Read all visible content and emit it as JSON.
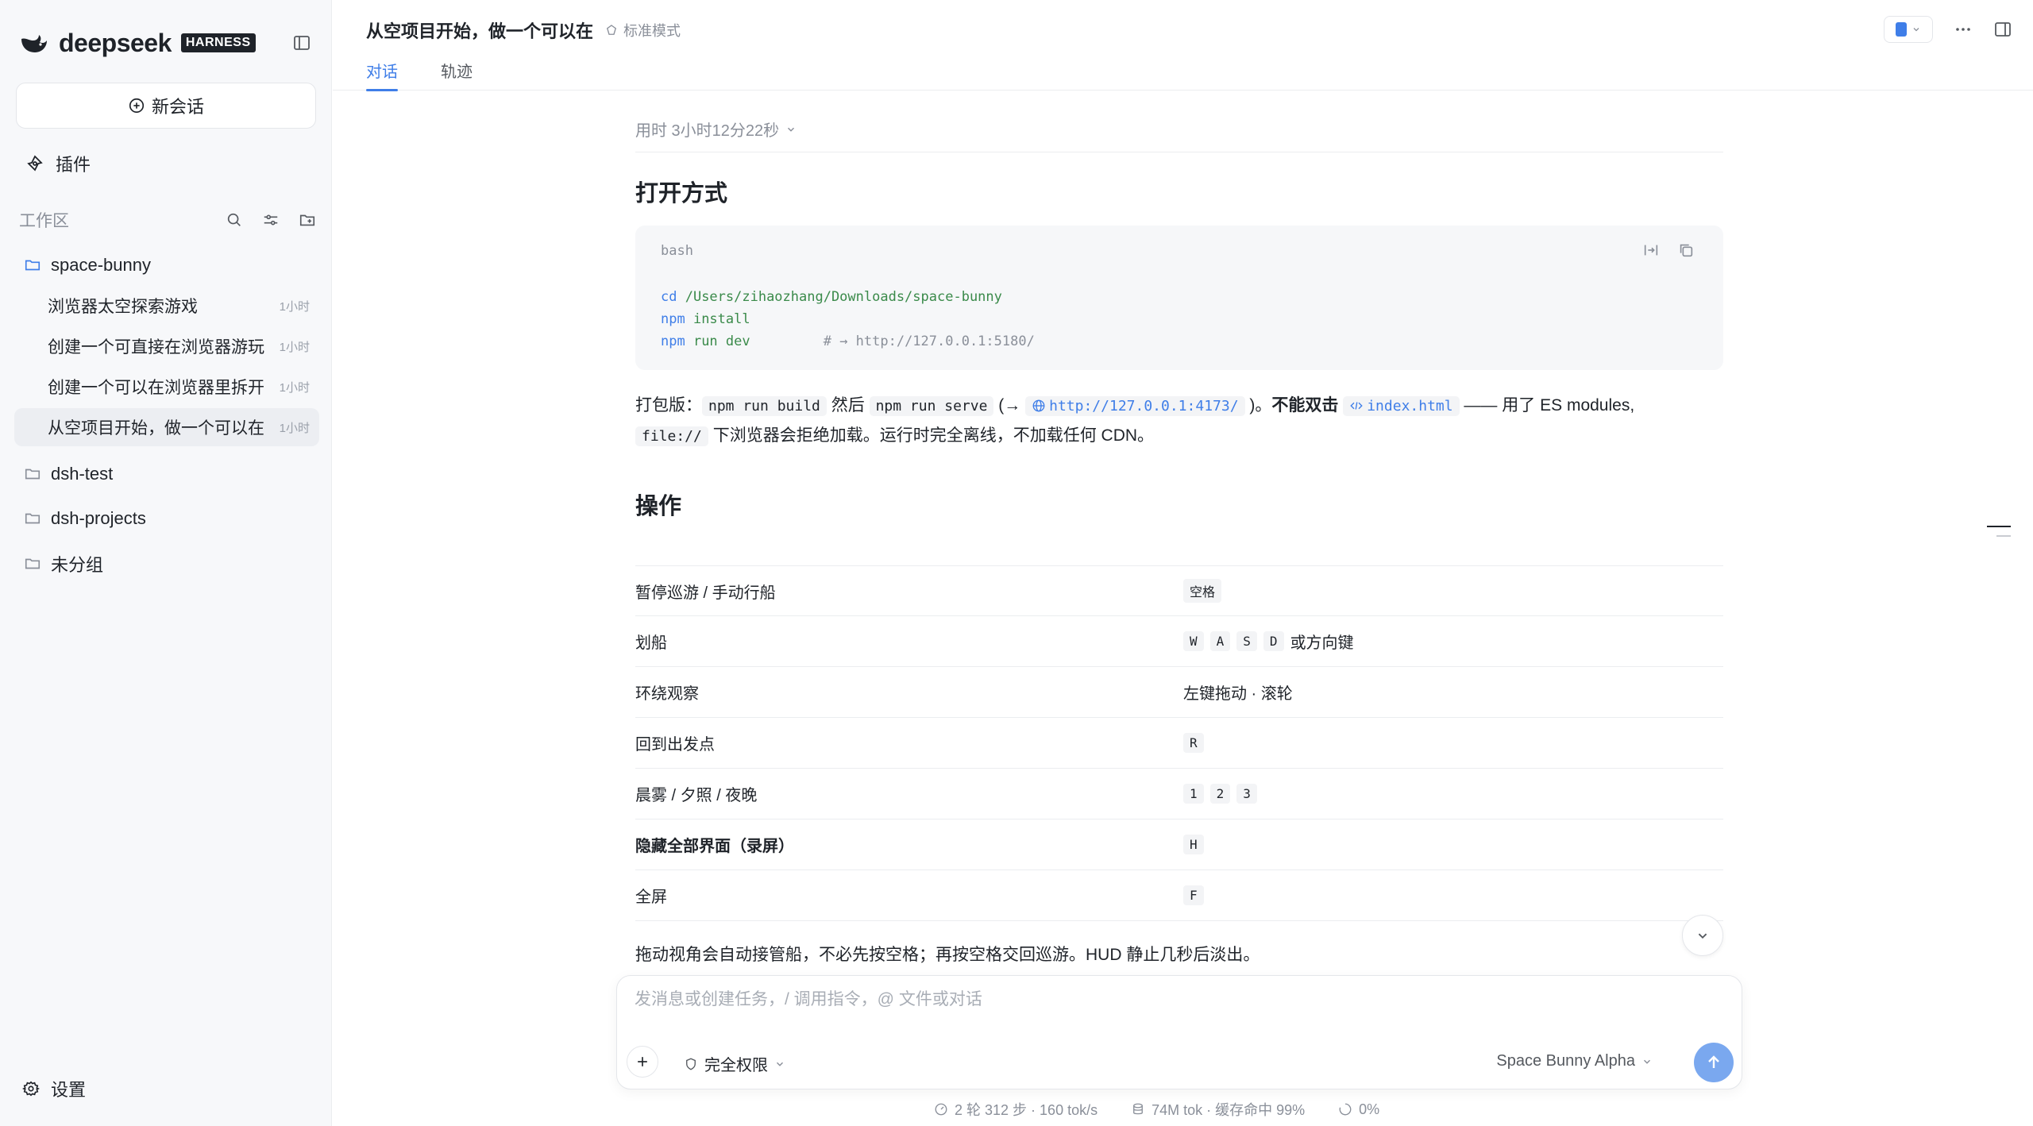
{
  "sidebar": {
    "brand_name": "deepseek",
    "brand_badge": "HARNESS",
    "new_chat_label": "新会话",
    "plugins_label": "插件",
    "workspace_title": "工作区",
    "folders": [
      {
        "name": "space-bunny",
        "sessions": [
          {
            "label": "浏览器太空探索游戏",
            "time": "1小时"
          },
          {
            "label": "创建一个可直接在浏览器游玩",
            "time": "1小时"
          },
          {
            "label": "创建一个可以在浏览器里拆开",
            "time": "1小时"
          },
          {
            "label": "从空项目开始，做一个可以在",
            "time": "1小时"
          }
        ]
      },
      {
        "name": "dsh-test"
      },
      {
        "name": "dsh-projects"
      },
      {
        "name": "未分组"
      }
    ],
    "settings_label": "设置"
  },
  "header": {
    "conversation_title": "从空项目开始，做一个可以在",
    "mode_label": "标准模式",
    "tabs": [
      "对话",
      "轨迹"
    ]
  },
  "content": {
    "elapsed": "用时 3小时12分22秒",
    "section_open": "打开方式",
    "code": {
      "lang": "bash",
      "line1_cmd": "cd",
      "line1_arg": " /Users/zihaozhang/Downloads/space-bunny",
      "line2_cmd": "npm",
      "line2_arg": " install",
      "line3_cmd": "npm",
      "line3_arg": " run dev",
      "line3_comment": "         # → http://127.0.0.1:5180/"
    },
    "para1": {
      "prefix": "打包版：",
      "code_build": "npm run build",
      "then": " 然后 ",
      "code_serve": "npm run serve",
      "arrow": " (→ ",
      "url": "http://127.0.0.1:4173/",
      "close": " )。",
      "no_dbl": "不能双击",
      "file": "index.html",
      "rest": " —— 用了 ES modules,"
    },
    "para2": {
      "code_file": "file://",
      "rest": " 下浏览器会拒绝加载。运行时完全离线，不加载任何 CDN。"
    },
    "section_ops": "操作",
    "ops": [
      {
        "action": "暂停巡游 / 手动行船",
        "keys": [
          "空格"
        ],
        "suffix": ""
      },
      {
        "action": "划船",
        "keys": [
          "W",
          "A",
          "S",
          "D"
        ],
        "suffix": "或方向键"
      },
      {
        "action": "环绕观察",
        "keys": [],
        "suffix": "左键拖动 · 滚轮"
      },
      {
        "action": "回到出发点",
        "keys": [
          "R"
        ],
        "suffix": ""
      },
      {
        "action": "晨雾 / 夕照 / 夜晚",
        "keys": [
          "1",
          "2",
          "3"
        ],
        "suffix": ""
      },
      {
        "action": "隐藏全部界面（录屏）",
        "keys": [
          "H"
        ],
        "suffix": "",
        "bold": true
      },
      {
        "action": "全屏",
        "keys": [
          "F"
        ],
        "suffix": ""
      }
    ],
    "tip": "拖动视角会自动接管船，不必先按空格；再按空格交回巡游。HUD 静止几秒后淡出。"
  },
  "composer": {
    "placeholder": "发消息或创建任务，/ 调用指令，@ 文件或对话",
    "permission_label": "完全权限",
    "model_label": "Space Bunny Alpha"
  },
  "status": {
    "steps": "2 轮 312 步 · 160 tok/s",
    "tokens": "74M tok · 缓存命中 99%",
    "progress": "0%"
  },
  "colors": {
    "accent": "#3f7ee8",
    "send_button": "#7aa8ef",
    "sidebar_bg": "#f7f8fa"
  }
}
